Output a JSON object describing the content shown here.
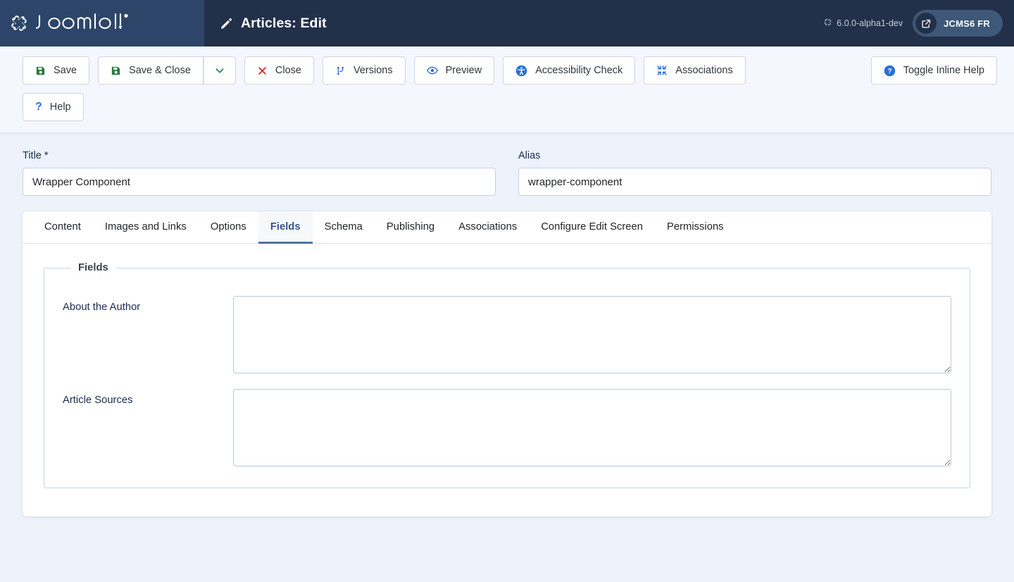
{
  "header": {
    "brand_name": "Joomla!",
    "brand_icon": "joomla-logo-icon",
    "title": "Articles: Edit",
    "title_icon": "pencil-icon",
    "version_icon": "joomla-mark-icon",
    "version_text": "6.0.0-alpha1-dev",
    "site_link": {
      "icon": "external-link-icon",
      "label": "JCMS6 FR"
    }
  },
  "toolbar": {
    "buttons": [
      {
        "id": "save",
        "label": "Save",
        "icon": "floppy-disk-icon",
        "icon_color": "#287a3b"
      },
      {
        "id": "save-close",
        "label": "Save & Close",
        "icon": "floppy-disk-icon",
        "icon_color": "#287a3b"
      },
      {
        "id": "save-dropdown",
        "label": "",
        "icon": "chevron-down-icon",
        "icon_color": "#287a3b"
      },
      {
        "id": "close",
        "label": "Close",
        "icon": "close-x-icon",
        "icon_color": "#d0252b"
      },
      {
        "id": "versions",
        "label": "Versions",
        "icon": "code-branch-icon",
        "icon_color": "#2a6fd6"
      },
      {
        "id": "preview",
        "label": "Preview",
        "icon": "eye-icon",
        "icon_color": "#2a6fd6"
      },
      {
        "id": "accessibility-check",
        "label": "Accessibility Check",
        "icon": "universal-access-icon",
        "icon_color": "#2a6fd6"
      },
      {
        "id": "associations",
        "label": "Associations",
        "icon": "arrows-in-icon",
        "icon_color": "#2a6fd6"
      },
      {
        "id": "toggle-inline-help",
        "label": "Toggle Inline Help",
        "icon": "question-circle-icon",
        "icon_color": "#2a6fd6"
      },
      {
        "id": "help",
        "label": "Help",
        "icon": "question-mark-icon",
        "icon_color": "#2a6fd6"
      }
    ],
    "save_label": "Save",
    "save_close_label": "Save & Close",
    "close_label": "Close",
    "versions_label": "Versions",
    "preview_label": "Preview",
    "accessibility_label": "Accessibility Check",
    "associations_label": "Associations",
    "toggle_help_label": "Toggle Inline Help",
    "help_label": "Help"
  },
  "form": {
    "title_field": {
      "label": "Title *",
      "value": "Wrapper Component",
      "placeholder": ""
    },
    "alias_field": {
      "label": "Alias",
      "value": "wrapper-component",
      "placeholder": ""
    }
  },
  "tabs": [
    {
      "id": "content",
      "label": "Content",
      "active": false
    },
    {
      "id": "images-and-links",
      "label": "Images and Links",
      "active": false
    },
    {
      "id": "options",
      "label": "Options",
      "active": false
    },
    {
      "id": "fields",
      "label": "Fields",
      "active": true
    },
    {
      "id": "schema",
      "label": "Schema",
      "active": false
    },
    {
      "id": "publishing",
      "label": "Publishing",
      "active": false
    },
    {
      "id": "associations",
      "label": "Associations",
      "active": false
    },
    {
      "id": "configure-edit-screen",
      "label": "Configure Edit Screen",
      "active": false
    },
    {
      "id": "permissions",
      "label": "Permissions",
      "active": false
    }
  ],
  "fields_panel": {
    "legend": "Fields",
    "rows": [
      {
        "id": "about-the-author",
        "label": "About the Author",
        "value": "",
        "placeholder": ""
      },
      {
        "id": "article-sources",
        "label": "Article Sources",
        "value": "",
        "placeholder": ""
      }
    ]
  },
  "colors": {
    "header_bg": "#22304a",
    "brand_bg": "#2d4568",
    "page_bg": "#edf2fb",
    "accent_blue": "#2a6fd6",
    "active_tab": "#36568c",
    "save_green": "#287a3b",
    "close_red": "#d0252b"
  }
}
